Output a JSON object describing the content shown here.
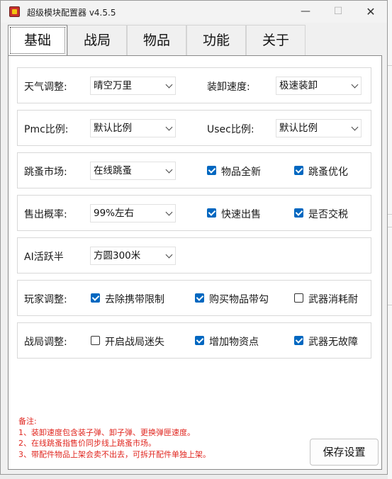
{
  "window": {
    "title": "超级模块配置器 v4.5.5",
    "min_glyph": "—",
    "max_glyph": "☐",
    "close_glyph": "✕"
  },
  "tabs": [
    "基础",
    "战局",
    "物品",
    "功能",
    "关于"
  ],
  "active_tab": "基础",
  "rows": {
    "weather": {
      "label": "天气调整:",
      "value": "晴空万里"
    },
    "load_speed": {
      "label": "装卸速度:",
      "value": "极速装卸"
    },
    "pmc": {
      "label": "Pmc比例:",
      "value": "默认比例"
    },
    "usec": {
      "label": "Usec比例:",
      "value": "默认比例"
    },
    "flea": {
      "label": "跳蚤市场:",
      "value": "在线跳蚤",
      "checks": [
        {
          "label": "物品全新",
          "checked": true
        },
        {
          "label": "跳蚤优化",
          "checked": true
        }
      ]
    },
    "sell": {
      "label": "售出概率:",
      "value": "99%左右",
      "checks": [
        {
          "label": "快速出售",
          "checked": true
        },
        {
          "label": "是否交税",
          "checked": true
        }
      ]
    },
    "ai": {
      "label": "AI活跃半",
      "value": "方圆300米"
    },
    "player": {
      "label": "玩家调整:",
      "checks": [
        {
          "label": "去除携带限制",
          "checked": true
        },
        {
          "label": "购买物品带勾",
          "checked": true
        },
        {
          "label": "武器消耗耐",
          "checked": false
        }
      ]
    },
    "raid": {
      "label": "战局调整:",
      "checks": [
        {
          "label": "开启战局迷失",
          "checked": false
        },
        {
          "label": "增加物资点",
          "checked": true
        },
        {
          "label": "武器无故障",
          "checked": true
        }
      ]
    }
  },
  "notes": {
    "title": "备注:",
    "lines": [
      "1、装卸速度包含装子弹、卸子弹、更换弹匣速度。",
      "2、在线跳蚤指售价同步线上跳蚤市场。",
      "3、带配件物品上架会卖不出去，可拆开配件单独上架。"
    ]
  },
  "save_label": "保存设置",
  "colors": {
    "accent": "#0067c0",
    "notes": "#e0261f"
  }
}
